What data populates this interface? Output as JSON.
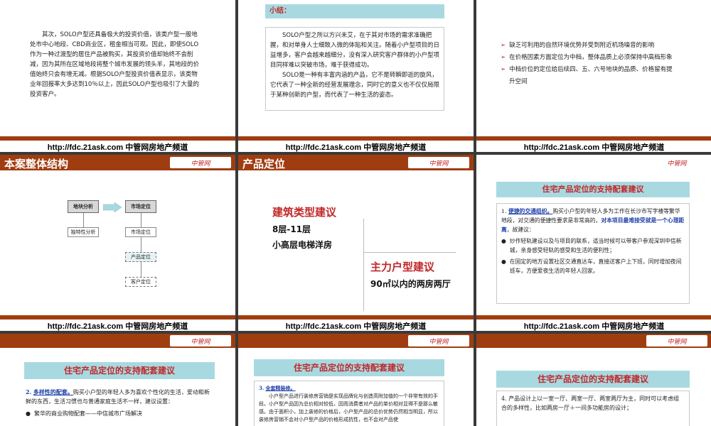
{
  "footer": {
    "text": "http://fdc.21ask.com   中管网房地产频道"
  },
  "logo": {
    "text": "中管网"
  },
  "s1": {
    "paragraph": "其次，SOLO户型还具备极大的投资价值，该类户型一般地处市中心地段、CBD商业区，租金相当可观。因此，即使SOLO作为一种过渡型的居住产品被购买，其投资价值却始终不会削减，因为其所在区域地段将整个城市发展的领头羊，其地段的价值始终只会有增无减。根据SOLO户型投资价值表显示，该类物业年回报率大多达到10％以上，因此SOLO户型也吸引了大量的投资客户。"
  },
  "s2": {
    "heading": "小结：",
    "p1": "SOLO户型之所以方兴未艾，在于其对市场的需求准确把握，和对单身人士细致入微的体贴和关注。随着小户型项目的日益增多，客户会越来越细分，没有深入研究客户群体的小户型项目同样难以突破市场，难于获得成功。",
    "p2": "SOLO是一种有丰富内涵的产品，它不是转瞬即逝的旋风，它代表了一种全新的经营发展理念，同时它的意义也不仅仅局限于某种创新的户型，而代表了一种生活的姿态。"
  },
  "s3": {
    "items": [
      "缺乏可利用的自然环境优势并受到附近机场噪音的影响",
      "在价格因素方面定位为中档，整体品质上必须保持中高档形象",
      "中档价位的定位给后续四、五、六号地块的品质、价格留有提升空间"
    ]
  },
  "s4": {
    "title": "本案整体结构",
    "box_a": "地块分析",
    "box_b": "市场定位",
    "box_a1": "独特性分析",
    "box_b1": "市场定位",
    "box_b2": "产品定位",
    "box_b3": "客户定位"
  },
  "s5": {
    "title": "产品定位",
    "h1": "建筑类型建议",
    "t1a": "8层-11层",
    "t1b": "小高层电梯洋房",
    "h2": "主力户型建议",
    "t2": "90㎡以内的两房两厅"
  },
  "s6": {
    "heading": "住宅产品定位的支持配套建议",
    "item1_num": "1.",
    "item1_link": "便捷的交通组织。",
    "item1_text": "购买小户型的年轻人多为工作在长沙市写字楼等繁华地段，对交通的便捷性要求是非常高的，",
    "item1_blue": "对本项目最难接受就是一个心理距离",
    "item1_tail": "，故建议：",
    "b1": "炒作轻轨建设以及与项目的联系，适当时候可以带客户参观深圳中信新城，亲身感受轻轨的感受和生活的便利性；",
    "b2": "在固定的地方设置社区交通直达车，直接送客户上下班，同时增加夜间班车，方便爱夜生活的年轻人回家。"
  },
  "s7": {
    "heading": "住宅产品定位的支持配套建议",
    "item2_num": "2.",
    "item2_link": "多样性的配套。",
    "item2_text": "购买小户型的年轻人多为喜欢个性化的生活，爱动和新鲜的东西，生活习惯也与普通家庭生活不一样，建议设置：",
    "b1": "繁华的商业购物配套——中信城市广场解决"
  },
  "s8": {
    "heading": "住宅产品定位的支持配套建议",
    "item3_num": "3.",
    "item3_link": "全套精装修。",
    "item3_text": "小户型产品进行装修房营销是实现品牌化与创造高附加值的一个非常有效的手段。小户型产品因为总价相对较低，因而消费者对产品的单价相对显得不是那么敏感。由于面积小，加上装修的价格后，小户型产品的总价优势仍然相当明显，所以装修房营销不会对小户型产品的价格形成抗性，也不会对产品使"
  },
  "s9": {
    "heading": "住宅产品定位的支持配套建议",
    "item4_num": "4.",
    "item4_text": "产品设计上以一室一厅、两室一厅、两室两厅为主，同时可以考虑组合的多样性，比如两房一厅＋一间多功能房的设计；"
  }
}
